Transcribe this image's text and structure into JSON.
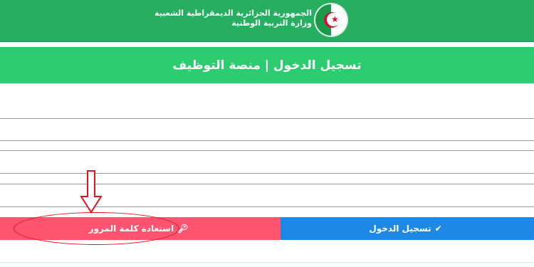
{
  "header": {
    "line1": "الجمهورية الجزائرية الديمقراطية الشعبية",
    "line2": "وزارة التربية الوطنية",
    "emblem_icon": "algeria-flag-emblem"
  },
  "title": {
    "text": "تسجيل الدخول | منصة التوظيف"
  },
  "actions": {
    "recover_label": "استعادة كلمة المرور",
    "recover_icon": "key-icon",
    "login_label": "تسجيل الدخول",
    "login_icon": "check-icon"
  },
  "colors": {
    "header_green": "#27ae60",
    "title_green": "#2ecc71",
    "recover_red": "#ff5470",
    "login_blue": "#1e88e5",
    "annotation_red": "#e0141c"
  }
}
